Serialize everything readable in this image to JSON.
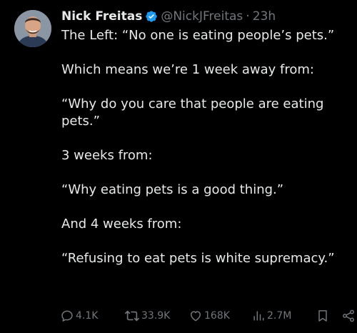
{
  "author": {
    "name": "Nick Freitas",
    "handle": "@NickJFreitas",
    "separator": "·",
    "time": "23h",
    "verified": true
  },
  "tweet": {
    "paragraphs": [
      "The Left: “No one is eating people’s pets.”",
      "Which means we’re  1 week away from:",
      "“Why do you care that people are eating pets.”",
      "3 weeks from:",
      "“Why eating pets is a good thing.”",
      "And 4 weeks from:",
      "“Refusing to eat pets is white supremacy.”"
    ]
  },
  "actions": {
    "replies": "4.1K",
    "reposts": "33.9K",
    "likes": "168K",
    "views": "2.7M"
  },
  "colors": {
    "background": "#000000",
    "text": "#e7e9ea",
    "muted": "#71767b",
    "verified_blue": "#1d9bf0"
  },
  "icons": [
    "verified-badge-icon",
    "reply-icon",
    "repost-icon",
    "like-icon",
    "views-icon",
    "bookmark-icon",
    "share-icon"
  ]
}
